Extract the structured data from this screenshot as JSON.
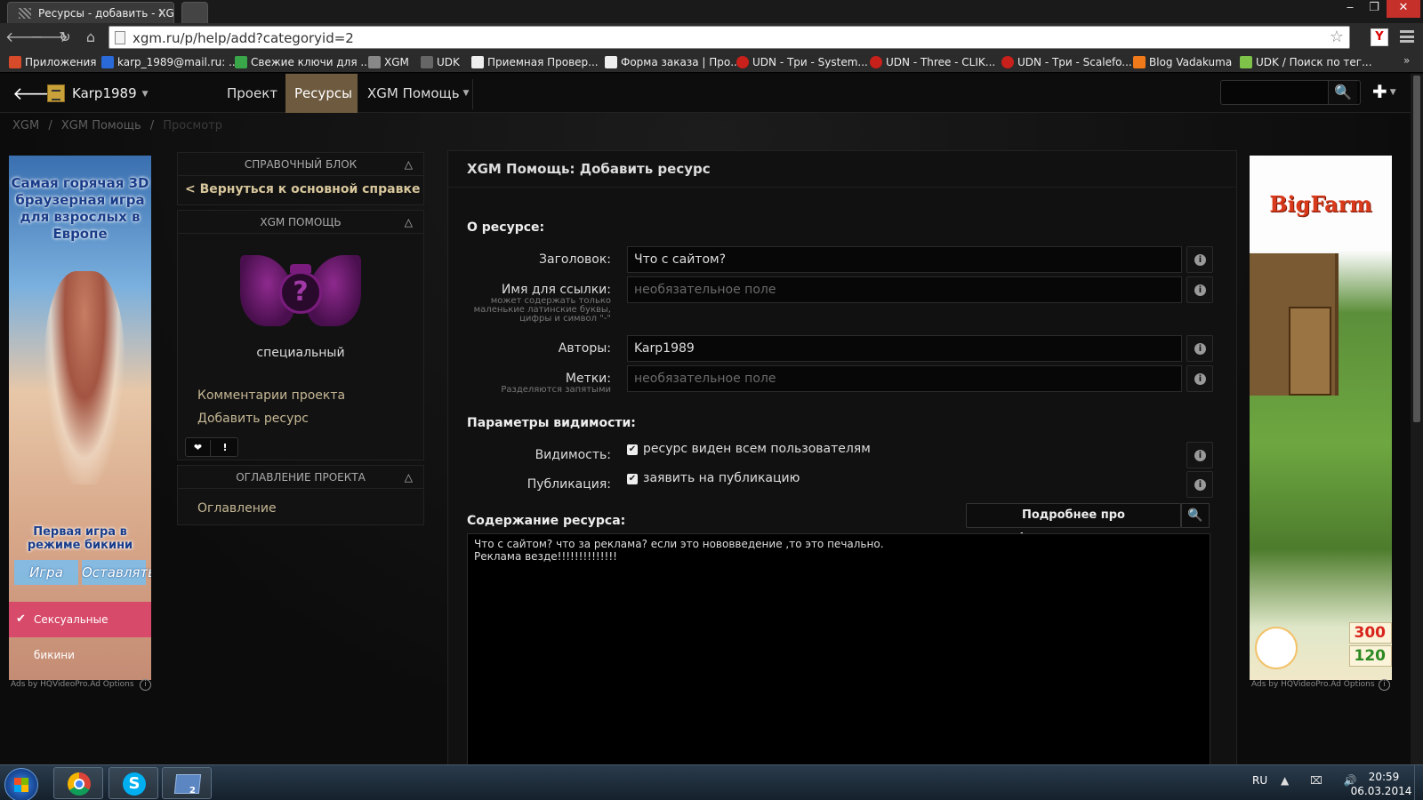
{
  "browser": {
    "tab_title": "Ресурсы - добавить - XGI",
    "close_glyph": "×",
    "url": "xgm.ru/p/help/add?categoryid=2",
    "window_controls": {
      "minimize": "‒",
      "maximize": "❐",
      "close": "✕"
    },
    "nav": {
      "back": "🡐",
      "forward": "🡒",
      "reload": "↻",
      "home": "⌂"
    },
    "star": "☆",
    "ext_label": "Y",
    "bookmarks": [
      {
        "label": "Приложения",
        "color": "#d74a2a"
      },
      {
        "label": "karp_1989@mail.ru: ...",
        "color": "#2a6ad8"
      },
      {
        "label": "Свежие ключи для ...",
        "color": "#3aa64a"
      },
      {
        "label": "XGM",
        "color": "#888888"
      },
      {
        "label": "UDK",
        "color": "#666666"
      },
      {
        "label": "Приемная Провер...",
        "color": "#eeeeee"
      },
      {
        "label": "Форма заказа | Про...",
        "color": "#eeeeee"
      },
      {
        "label": "UDN - Три - System...",
        "color": "#c8201a"
      },
      {
        "label": "UDN - Three - CLIK...",
        "color": "#c8201a"
      },
      {
        "label": "UDN - Три - Scalefo...",
        "color": "#c8201a"
      },
      {
        "label": "Blog Vadakuma",
        "color": "#f07a1a"
      },
      {
        "label": "UDK / Поиск по тег...",
        "color": "#7fc24a"
      }
    ],
    "bookmarks_more": "»"
  },
  "site": {
    "back_glyph": "🡐",
    "username": "Karp1989",
    "caret": "▼",
    "nav": {
      "project": "Проект",
      "resources": "Ресурсы",
      "help": "XGM Помощь"
    },
    "search_glyph": "🔍",
    "plus_glyph": "✚",
    "breadcrumbs": [
      "XGM",
      "/",
      "XGM Помощь",
      "/",
      "Просмотр"
    ]
  },
  "ads": {
    "left": {
      "headline": "Самая горячая 3D браузерная игра для взрослых в Европе",
      "tagline": "Первая игра в режиме бикини",
      "btn_play": "Игра",
      "btn_leave": "Оставлять",
      "footer": "Сексуальные бикини",
      "label": "Ads by HQVideoPro.Ad Options",
      "info": "i"
    },
    "right": {
      "logo": "BigFarm",
      "coins": "300",
      "cash": "120",
      "label": "Ads by HQVideoPro.Ad Options",
      "info": "i"
    }
  },
  "sidebar": {
    "ref_block": {
      "header": "СПРАВОЧНЫЙ БЛОК",
      "toggle": "△",
      "back_link": "< Вернуться к основной справке"
    },
    "help_block": {
      "header": "XGM ПОМОЩЬ",
      "toggle": "△",
      "emblem_glyph": "?",
      "label": "специальный",
      "links": [
        "Комментарии проекта",
        "Добавить ресурс"
      ],
      "btn_heart": "❤",
      "btn_alert": "!"
    },
    "toc_block": {
      "header": "ОГЛАВЛЕНИЕ ПРОЕКТА",
      "toggle": "△",
      "link": "Оглавление"
    }
  },
  "form": {
    "title": "XGM Помощь: Добавить ресурс",
    "section_about": "О ресурсе:",
    "title_label": "Заголовок:",
    "title_value": "Что с сайтом?",
    "slug_label": "Имя для ссылки:",
    "slug_hint": "может содержать только маленькие латинские буквы, цифры и символ \"-\"",
    "slug_placeholder": "необязательное поле",
    "authors_label": "Авторы:",
    "authors_value": "Karp1989",
    "tags_label": "Метки:",
    "tags_hint": "Разделяются запятыми",
    "tags_placeholder": "необязательное поле",
    "section_visibility": "Параметры видимости:",
    "visibility_label": "Видимость:",
    "visibility_checkbox": "ресурс виден всем пользователям",
    "publish_label": "Публикация:",
    "publish_checkbox": "заявить на публикацию",
    "check_glyph": "✔",
    "info_glyph": "i",
    "section_content": "Содержание ресурса:",
    "format_button": "Подробнее про форматирование",
    "format_search_glyph": "🔍",
    "content_text": "Что с сайтом? что за реклама? если это нововведение ,то это печально.\nРеклама везде!!!!!!!!!!!!!!"
  },
  "taskbar": {
    "skype_letter": "S",
    "files_count": "2",
    "lang": "RU",
    "tray": "▲ ⌧ 🔊",
    "time": "20:59",
    "date": "06.03.2014"
  }
}
